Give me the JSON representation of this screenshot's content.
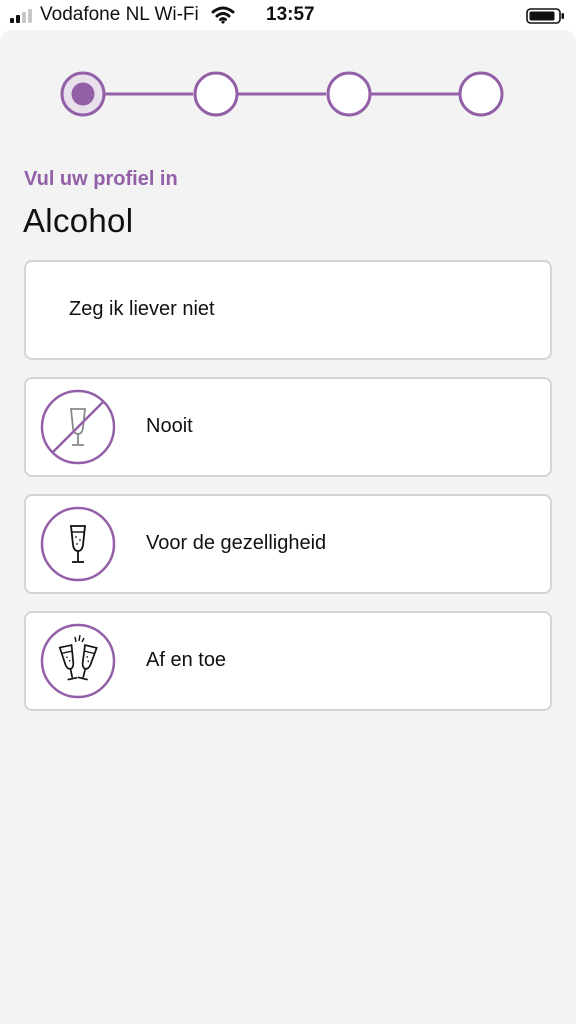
{
  "status_bar": {
    "carrier": "Vodafone NL Wi-Fi",
    "time": "13:57"
  },
  "stepper": {
    "steps": 4,
    "current_step": 1,
    "accent_color": "#9360a8"
  },
  "header": {
    "subtitle": "Vul uw profiel in",
    "title": "Alcohol"
  },
  "options": [
    {
      "label": "Zeg ik liever niet",
      "icon": "none"
    },
    {
      "label": "Nooit",
      "icon": "no-alcohol-icon"
    },
    {
      "label": "Voor de gezelligheid",
      "icon": "champagne-glass-icon"
    },
    {
      "label": "Af en toe",
      "icon": "cheers-icon"
    }
  ],
  "colors": {
    "accent": "#9360a8",
    "background": "#f3f3f3",
    "card_border": "#d4d4d4"
  }
}
